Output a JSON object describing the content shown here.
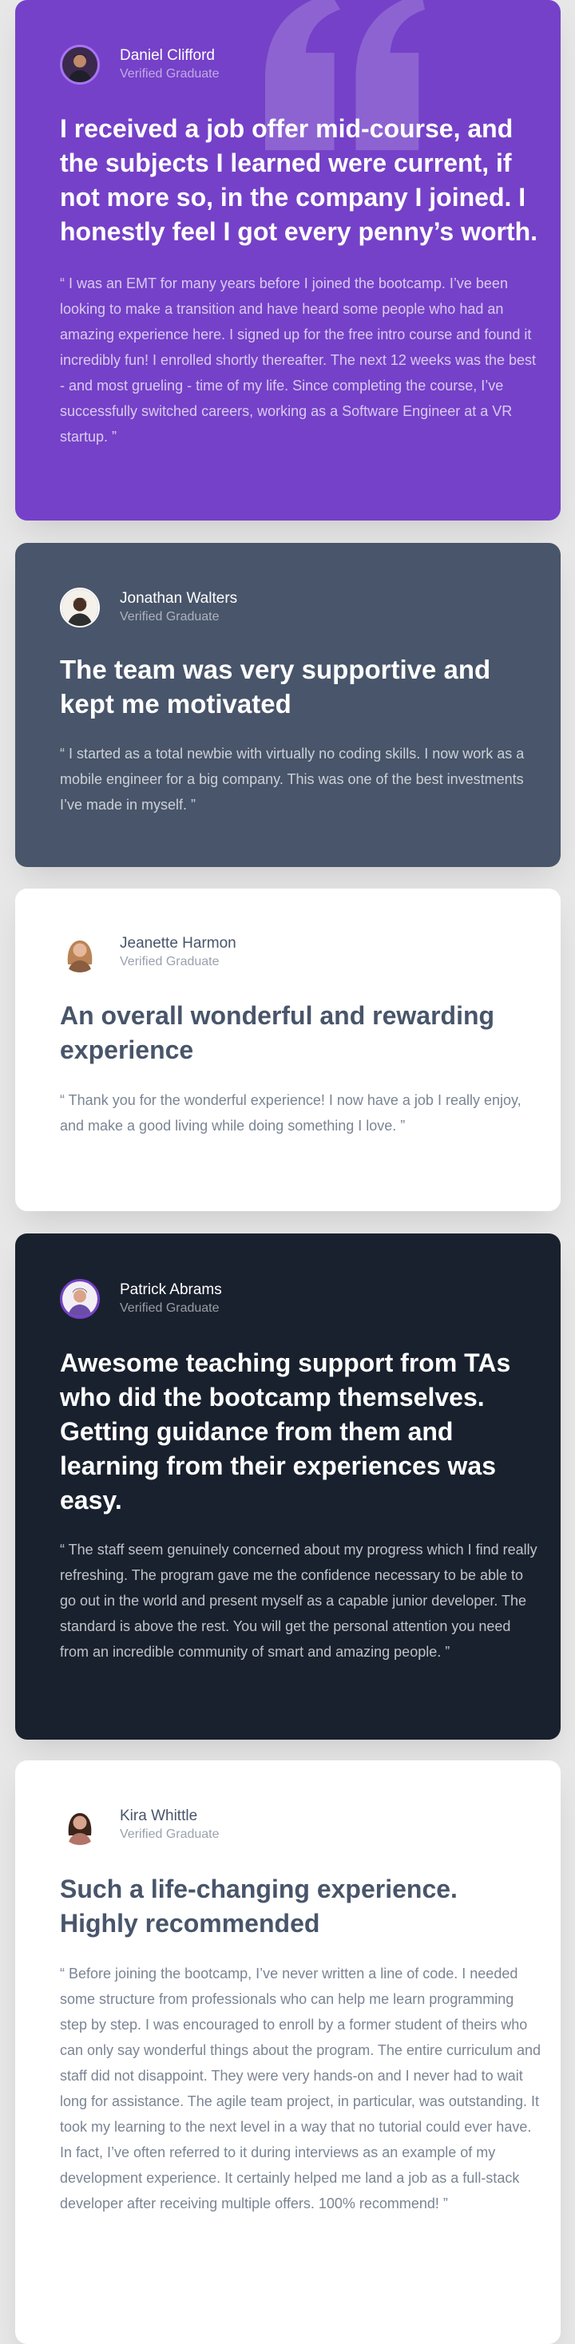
{
  "colors": {
    "page_bg": "#e7e7e7",
    "moderate_violet": "#7541c8",
    "grayish_blue": "#48556a",
    "white": "#ffffff",
    "very_dark_blue": "#19212e"
  },
  "testimonials": [
    {
      "name": "Daniel Clifford",
      "status": "Verified Graduate",
      "headline": "I received a job offer mid-course, and the subjects I learned were current, if not more so, in the company I joined. I honestly feel I got every penny’s worth.",
      "body": "“ I was an EMT for many years before I joined the bootcamp. I’ve been looking to make a transition and have heard some people who had an amazing experience here. I signed up for the free intro course and found it incredibly fun! I enrolled shortly thereafter. The next 12 weeks was the best - and most grueling - time of my life. Since completing the course, I’ve successfully switched careers, working as a Software Engineer at a VR startup. ”",
      "decoration_icon": "quotation-mark-icon"
    },
    {
      "name": "Jonathan Walters",
      "status": "Verified Graduate",
      "headline": "The team was very supportive and kept me motivated",
      "body": "“ I started as a total newbie with virtually no coding skills. I now work as a mobile engineer for a big company. This was one of the best investments I’ve made in myself. ”"
    },
    {
      "name": "Jeanette Harmon",
      "status": "Verified Graduate",
      "headline": "An overall wonderful and rewarding experience",
      "body": "“ Thank you for the wonderful experience! I now have a job I really enjoy, and make a good living while doing something I love. ”"
    },
    {
      "name": "Patrick Abrams",
      "status": "Verified Graduate",
      "headline": "Awesome teaching support from TAs who did the bootcamp themselves. Getting guidance from them and learning from their experiences was easy.",
      "body": "“ The staff seem genuinely concerned about my progress which I find really refreshing. The program gave me the confidence necessary to be able to go out in the world and present myself as a capable junior developer. The standard is above the rest. You will get the personal attention you need from an incredible community of smart and amazing people. ”"
    },
    {
      "name": "Kira Whittle",
      "status": "Verified Graduate",
      "headline": "Such a life-changing experience. Highly recommended",
      "body": "“ Before joining the bootcamp, I’ve never written a line of code. I needed some structure from professionals who can help me learn programming step by step. I was encouraged to enroll by a former student of theirs who can only say wonderful things about the program. The entire curriculum and staff did not disappoint. They were very hands-on and I never had to wait long for assistance. The agile team project, in particular, was outstanding. It took my learning to the next level in a way that no tutorial could ever have. In fact, I’ve often referred to it during interviews as an example of my development experience. It certainly helped me land a job as a full-stack developer after receiving multiple offers. 100% recommend! ”"
    }
  ]
}
